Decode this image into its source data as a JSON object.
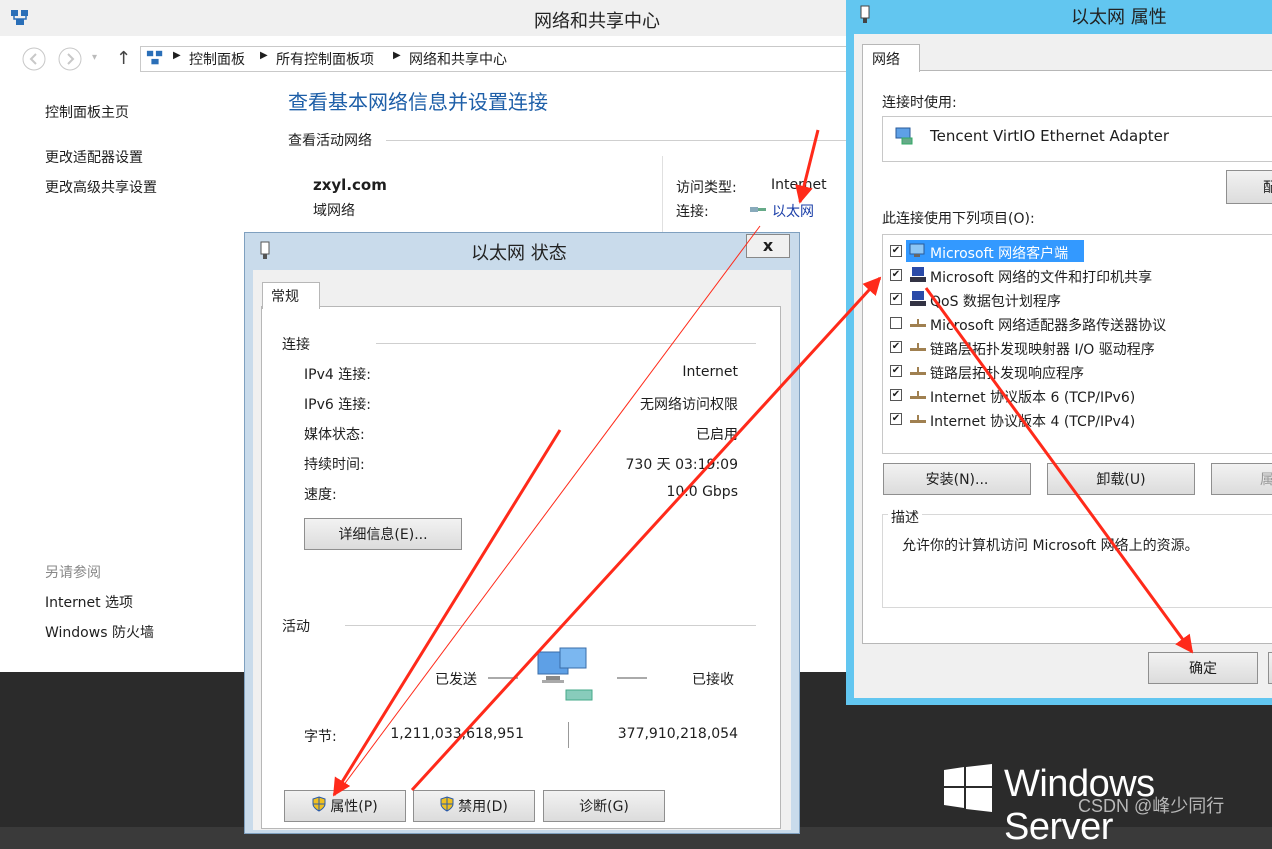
{
  "network_center": {
    "title": "网络和共享中心",
    "breadcrumb": [
      "控制面板",
      "所有控制面板项",
      "网络和共享中心"
    ],
    "sidebar": {
      "home": "控制面板主页",
      "links": [
        "更改适配器设置",
        "更改高级共享设置"
      ],
      "see_also_label": "另请参阅",
      "see_also": [
        "Internet 选项",
        "Windows 防火墙"
      ]
    },
    "main_heading": "查看基本网络信息并设置连接",
    "active_networks_label": "查看活动网络",
    "network_name": "zxyl.com",
    "network_type": "域网络",
    "access_type_label": "访问类型:",
    "access_type_value": "Internet",
    "connection_label": "连接:",
    "connection_value": "以太网"
  },
  "status_dialog": {
    "title": "以太网 状态",
    "close": "x",
    "tab": "常规",
    "connection_section": "连接",
    "rows": [
      {
        "label": "IPv4 连接:",
        "value": "Internet"
      },
      {
        "label": "IPv6 连接:",
        "value": "无网络访问权限"
      },
      {
        "label": "媒体状态:",
        "value": "已启用"
      },
      {
        "label": "持续时间:",
        "value": "730 天 03:19:09"
      },
      {
        "label": "速度:",
        "value": "10.0 Gbps"
      }
    ],
    "details_button": "详细信息(E)...",
    "activity_section": "活动",
    "sent_label": "已发送",
    "received_label": "已接收",
    "bytes_label": "字节:",
    "bytes_sent": "1,211,033,618,951",
    "bytes_received": "377,910,218,054",
    "buttons": {
      "properties": "属性(P)",
      "disable": "禁用(D)",
      "diagnose": "诊断(G)"
    }
  },
  "properties_dialog": {
    "title": "以太网 属性",
    "tab": "网络",
    "connect_using_label": "连接时使用:",
    "adapter_name": "Tencent VirtIO Ethernet Adapter",
    "configure_button": "配",
    "items_label": "此连接使用下列项目(O):",
    "items": [
      {
        "label": "Microsoft 网络客户端",
        "checked": true,
        "icon": "client-icon",
        "selected": true
      },
      {
        "label": "Microsoft 网络的文件和打印机共享",
        "checked": true,
        "icon": "share-icon",
        "selected": false
      },
      {
        "label": "QoS 数据包计划程序",
        "checked": true,
        "icon": "share-icon",
        "selected": false
      },
      {
        "label": "Microsoft 网络适配器多路传送器协议",
        "checked": false,
        "icon": "protocol-icon",
        "selected": false
      },
      {
        "label": "链路层拓扑发现映射器 I/O 驱动程序",
        "checked": true,
        "icon": "protocol-icon",
        "selected": false
      },
      {
        "label": "链路层拓扑发现响应程序",
        "checked": true,
        "icon": "protocol-icon",
        "selected": false
      },
      {
        "label": "Internet 协议版本 6 (TCP/IPv6)",
        "checked": true,
        "icon": "protocol-icon",
        "selected": false
      },
      {
        "label": "Internet 协议版本 4 (TCP/IPv4)",
        "checked": true,
        "icon": "protocol-icon",
        "selected": false
      }
    ],
    "install_button": "安装(N)...",
    "uninstall_button": "卸载(U)",
    "props_button": "属",
    "description_label": "描述",
    "description_text": "允许你的计算机访问 Microsoft 网络上的资源。",
    "ok_button": "确定"
  },
  "desktop": {
    "brand": "Windows Server",
    "watermark": "CSDN @峰少同行"
  },
  "colors": {
    "arrow": "#ff2a1a",
    "selection": "#3399ff",
    "link": "#1a3ea8"
  }
}
